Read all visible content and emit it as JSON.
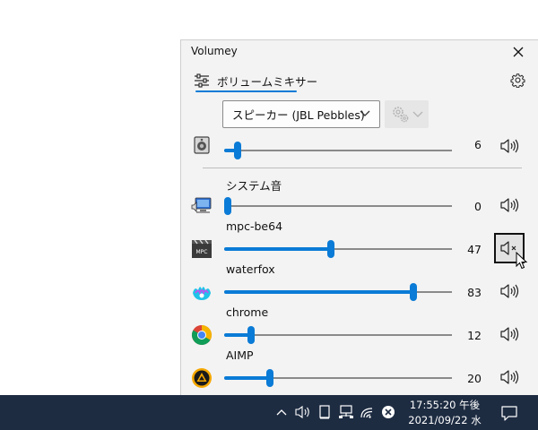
{
  "window": {
    "title": "Volumey",
    "tab_label": "ボリュームミキサー"
  },
  "device": {
    "selected": "スピーカー (JBL Pebbles)",
    "master_volume": 6
  },
  "sessions": [
    {
      "name": "システム音",
      "volume": 0,
      "icon": "system-sounds-icon"
    },
    {
      "name": "mpc-be64",
      "volume": 47,
      "icon": "mpc-be-icon"
    },
    {
      "name": "waterfox",
      "volume": 83,
      "icon": "waterfox-icon"
    },
    {
      "name": "chrome",
      "volume": 12,
      "icon": "chrome-icon"
    },
    {
      "name": "AIMP",
      "volume": 20,
      "icon": "aimp-icon"
    }
  ],
  "taskbar": {
    "time": "17:55:20 午後",
    "date": "2021/09/22 水"
  },
  "colors": {
    "accent": "#0a7bd6",
    "taskbar": "#1e2c42",
    "panel": "#f3f3f3"
  }
}
